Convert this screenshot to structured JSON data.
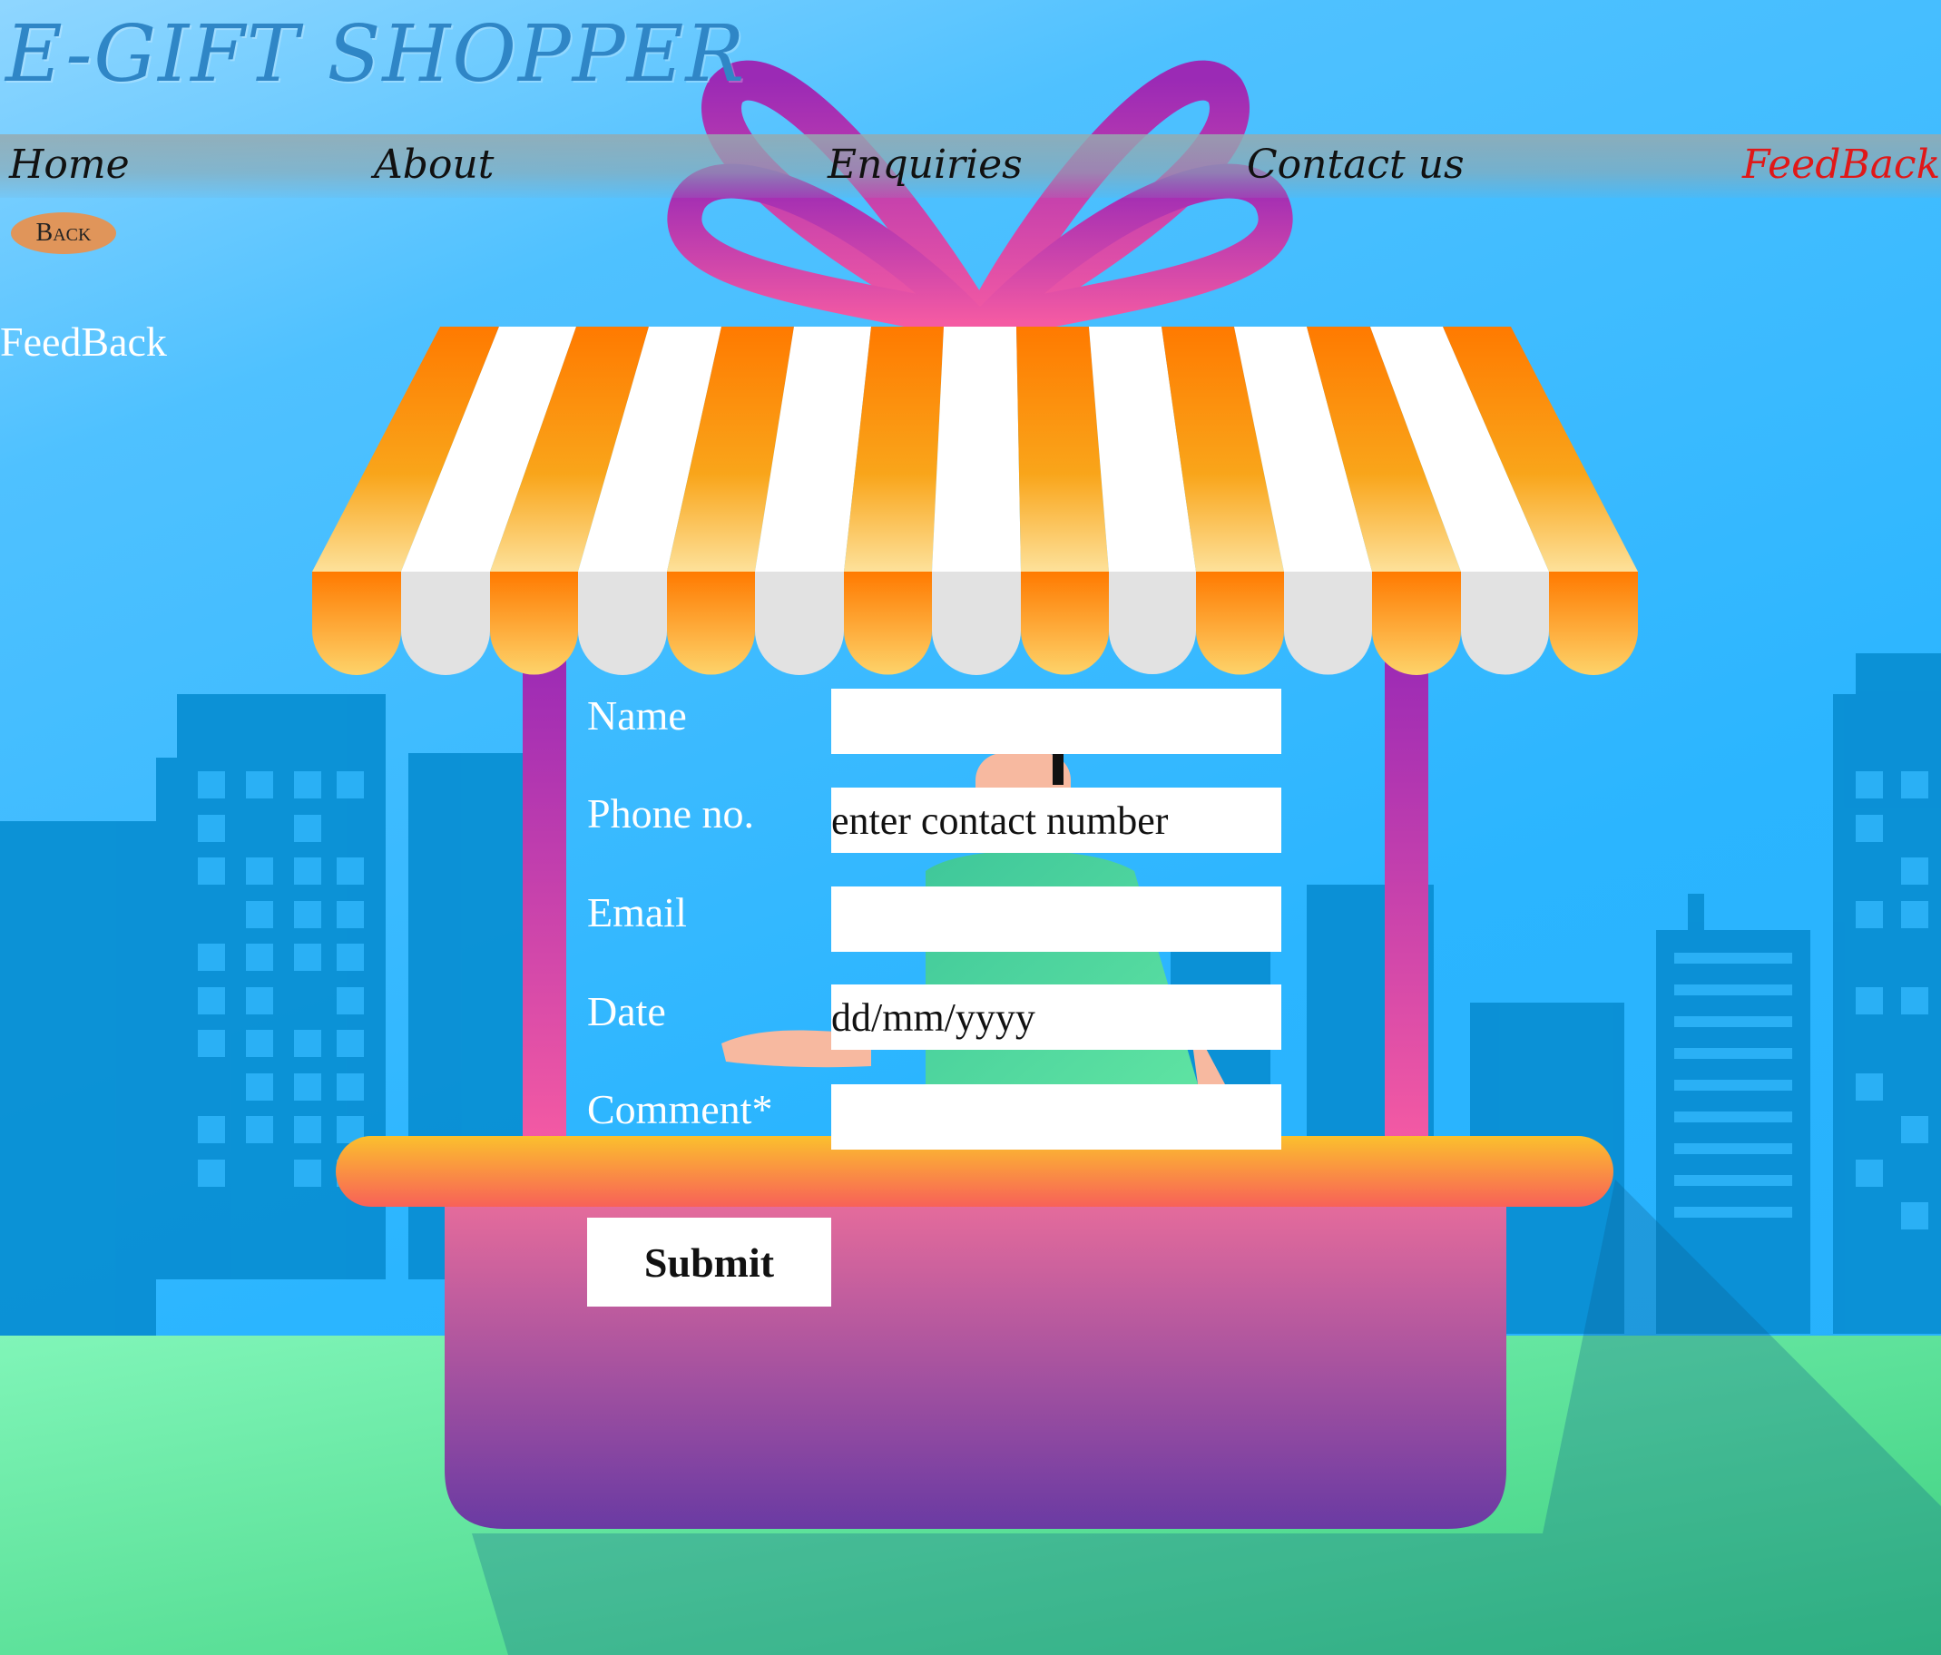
{
  "header": {
    "logo": "E-GIFT SHOPPER"
  },
  "nav": {
    "items": [
      {
        "label": "Home"
      },
      {
        "label": "About"
      },
      {
        "label": "Enquiries"
      },
      {
        "label": "Contact us"
      },
      {
        "label": "FeedBack",
        "active": true
      }
    ]
  },
  "back_button": {
    "label": "Back"
  },
  "page": {
    "title": "FeedBack"
  },
  "form": {
    "fields": [
      {
        "label": "Name",
        "value": "",
        "placeholder": ""
      },
      {
        "label": "Phone no.",
        "value": "",
        "placeholder": "enter contact number"
      },
      {
        "label": "Email",
        "value": "",
        "placeholder": ""
      },
      {
        "label": "Date",
        "value": "",
        "placeholder": "dd/mm/yyyy"
      },
      {
        "label": "Comment*",
        "value": "",
        "placeholder": ""
      }
    ],
    "submit_label": "Submit"
  },
  "theme": {
    "sky": "#2bb5ff",
    "logo_color": "#2f86c6",
    "active_nav_color": "#e01818",
    "back_button_color": "#e0955a",
    "awning_orange": "#f98a06",
    "counter_top": "#f7b733",
    "counter_body": "#e0689e",
    "ribbon": "#b22fb5",
    "ground": "#6de8a4"
  }
}
